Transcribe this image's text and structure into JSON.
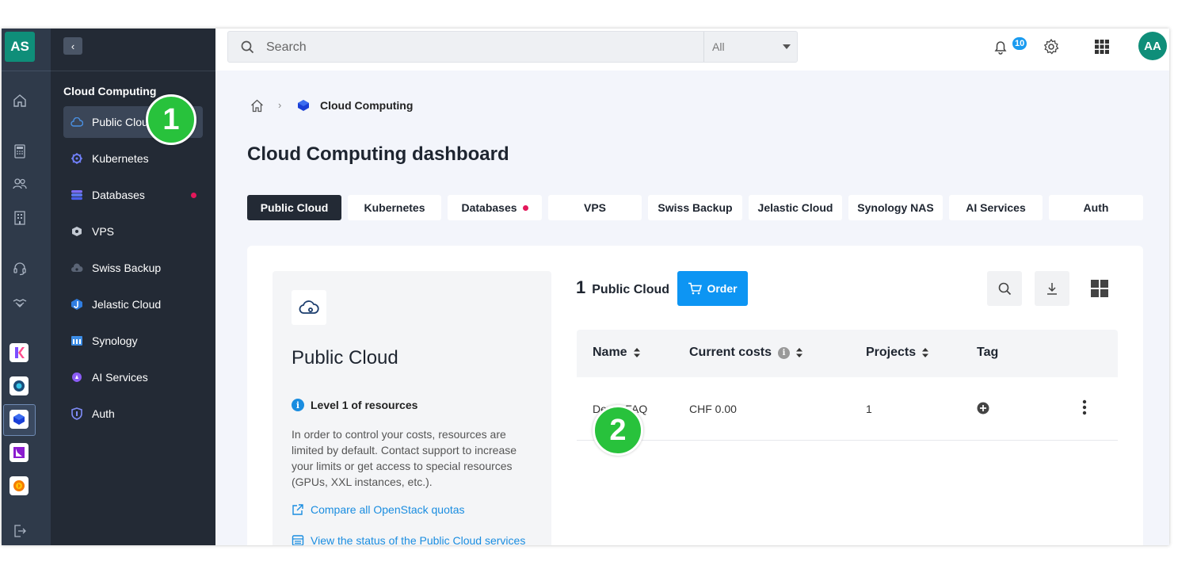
{
  "rail": {
    "logo": "AS"
  },
  "sidebar": {
    "section_title": "Cloud Computing",
    "items": [
      {
        "label": "Public Cloud",
        "icon": "cloud-icon"
      },
      {
        "label": "Kubernetes",
        "icon": "kubernetes-icon"
      },
      {
        "label": "Databases",
        "icon": "database-icon",
        "dot": true
      },
      {
        "label": "VPS",
        "icon": "hexagon-icon"
      },
      {
        "label": "Swiss Backup",
        "icon": "cloud-backup-icon"
      },
      {
        "label": "Jelastic Cloud",
        "icon": "jelastic-icon"
      },
      {
        "label": "Synology",
        "icon": "synology-icon"
      },
      {
        "label": "AI Services",
        "icon": "ai-icon"
      },
      {
        "label": "Auth",
        "icon": "shield-icon"
      }
    ]
  },
  "topbar": {
    "search_placeholder": "Search",
    "scope": "All",
    "notifications": "10",
    "avatar": "AA"
  },
  "breadcrumb": {
    "current": "Cloud Computing"
  },
  "page_title": "Cloud Computing dashboard",
  "tabs": [
    {
      "label": "Public Cloud",
      "active": true
    },
    {
      "label": "Kubernetes"
    },
    {
      "label": "Databases",
      "dot": true
    },
    {
      "label": "VPS"
    },
    {
      "label": "Swiss Backup"
    },
    {
      "label": "Jelastic Cloud"
    },
    {
      "label": "Synology NAS"
    },
    {
      "label": "AI Services"
    },
    {
      "label": "Auth"
    }
  ],
  "info_panel": {
    "title": "Public Cloud",
    "level": "Level 1 of resources",
    "description": "In order to control your costs, resources are limited by default. Contact support to increase your limits or get access to special resources (GPUs, XXL instances, etc.).",
    "link_quotas": "Compare all OpenStack quotas",
    "link_status": "View the status of the Public Cloud services"
  },
  "list": {
    "count": "1",
    "count_label": "Public Cloud",
    "order_label": "Order",
    "columns": [
      "Name",
      "Current costs",
      "Projects",
      "Tag"
    ],
    "rows": [
      {
        "name": "Demo FAQ",
        "cost": "CHF 0.00",
        "projects": "1"
      }
    ]
  },
  "markers": [
    "1",
    "2"
  ],
  "colors": {
    "accent": "#0d95f3",
    "brand": "#0f8e79",
    "sidebar": "#232a35",
    "marker": "#28c23c",
    "alert_dot": "#e3175a"
  }
}
